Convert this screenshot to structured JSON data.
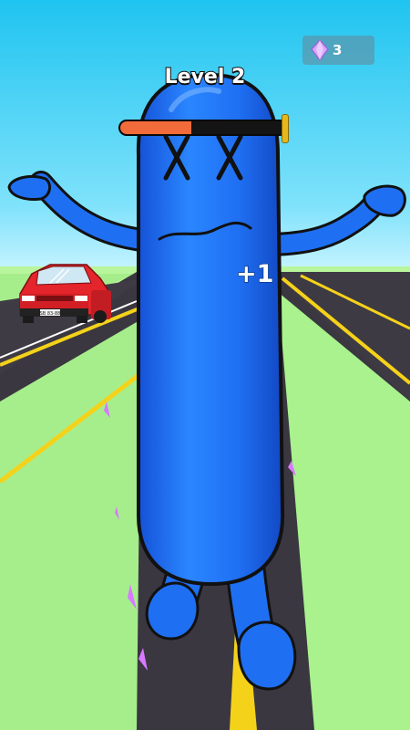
{
  "hud": {
    "level_text": "Level 2",
    "progress_fraction": 0.43,
    "progress_color": "#f26b3a",
    "gem_count": "3",
    "gem_icon": "diamond-gem-icon"
  },
  "scene": {
    "score_popup": "+1",
    "license_plate": "SB 83-88",
    "colors": {
      "sky_top": "#20c7f2",
      "sky_bottom": "#b7f1ff",
      "grass": "#a9f28e",
      "road": "#3a3740",
      "lane_yellow": "#f5d21a",
      "character_blue": "#1f6ff2",
      "car_red": "#e4252b"
    }
  }
}
